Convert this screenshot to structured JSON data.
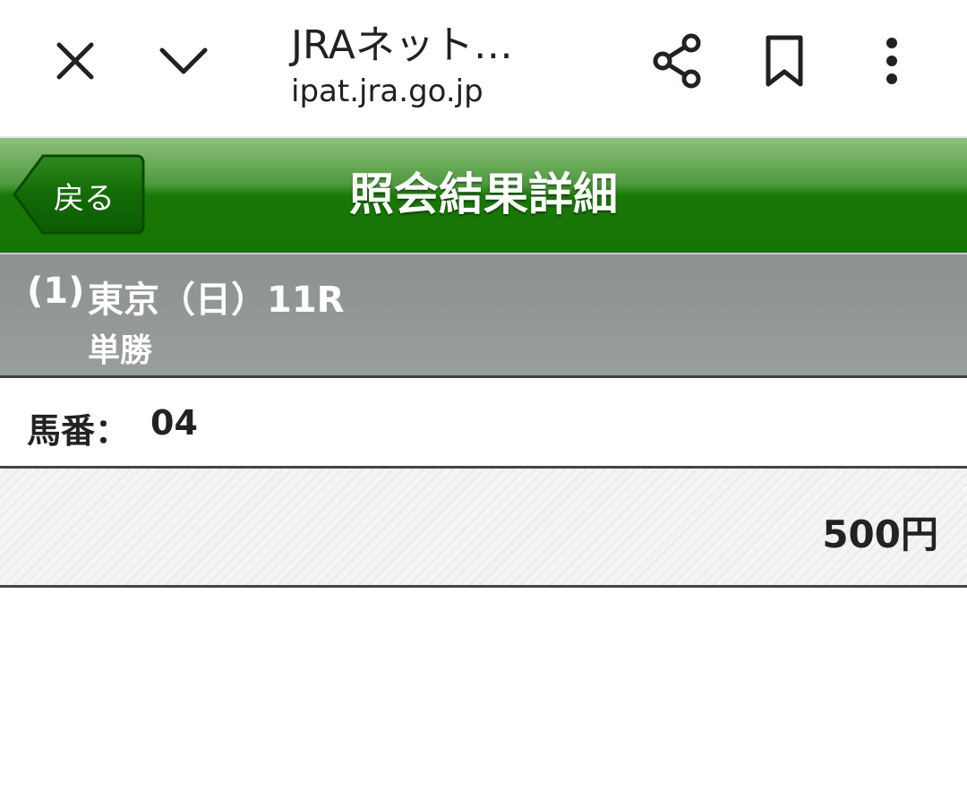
{
  "browser": {
    "tab_title": "JRAネット…",
    "url": "ipat.jra.go.jp",
    "icons": {
      "close": "close-icon",
      "collapse": "chevron-down-icon",
      "share": "share-icon",
      "bookmark": "bookmark-icon",
      "more": "more-vert-icon"
    }
  },
  "header": {
    "back_label": "戻る",
    "title": "照会結果詳細",
    "colors": {
      "header_green": "#197807",
      "back_button_green": "#0f6a05"
    }
  },
  "race": {
    "number": "(1)",
    "name": "東京（日）11R",
    "bet_type": "単勝"
  },
  "bet": {
    "horse_label": "馬番：",
    "horse_number": "04",
    "amount": "500円"
  }
}
